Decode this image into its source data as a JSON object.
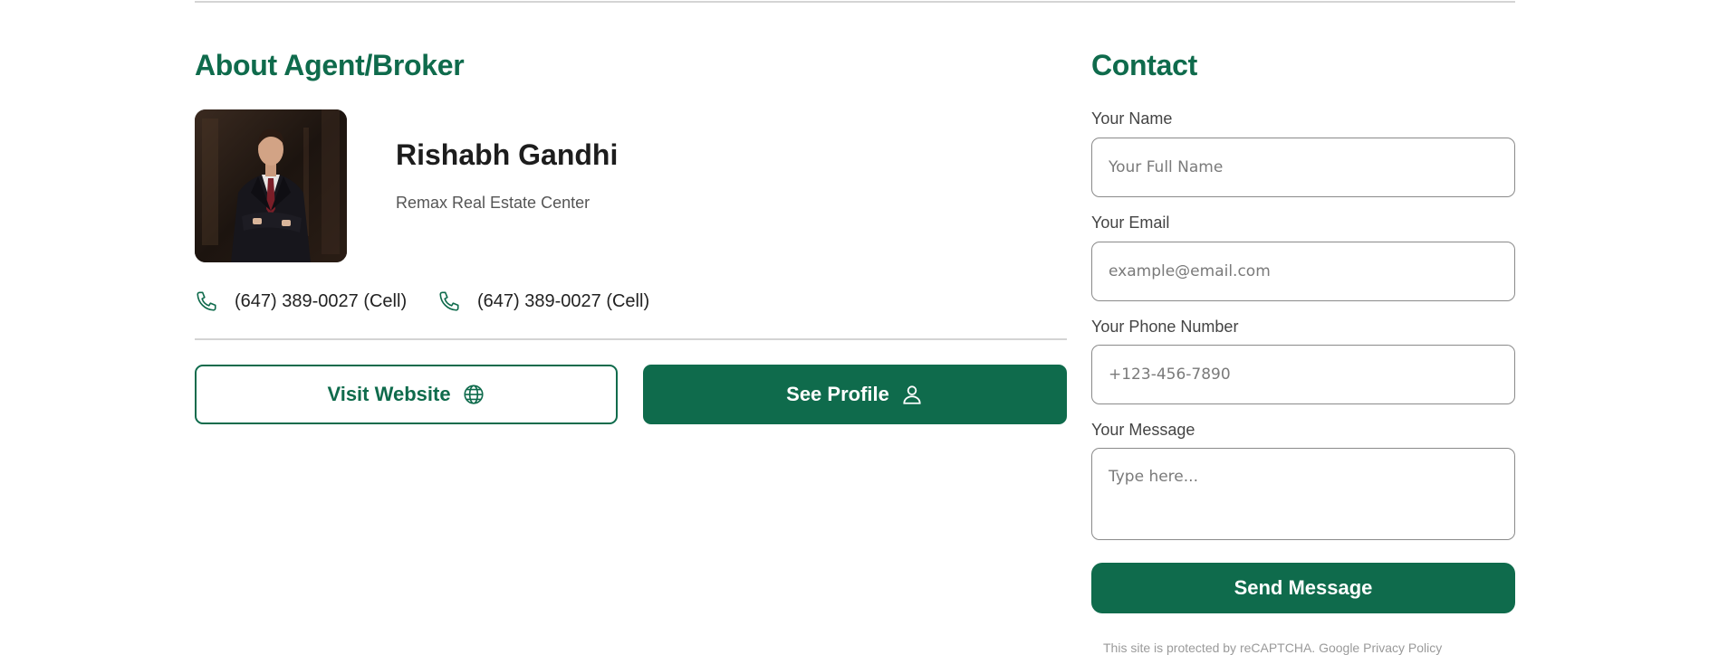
{
  "about": {
    "title": "About Agent/Broker",
    "agent": {
      "name": "Rishabh Gandhi",
      "agency": "Remax Real Estate Center"
    },
    "phones": [
      {
        "number": "(647) 389-0027 (Cell)",
        "icon": "phone-icon"
      },
      {
        "number": "(647) 389-0027 (Cell)",
        "icon": "phone-icon"
      }
    ],
    "buttons": {
      "visit_website": {
        "label": "Visit Website",
        "icon": "globe-icon"
      },
      "see_profile": {
        "label": "See Profile",
        "icon": "user-icon"
      }
    }
  },
  "contact": {
    "title": "Contact",
    "fields": {
      "name": {
        "label": "Your Name",
        "placeholder": "Your Full Name"
      },
      "email": {
        "label": "Your Email",
        "placeholder": "example@email.com"
      },
      "phone": {
        "label": "Your Phone Number",
        "placeholder": "+123-456-7890"
      },
      "message": {
        "label": "Your Message",
        "placeholder": "Type here..."
      }
    },
    "send_label": "Send Message",
    "recaptcha_note": "This site is protected by reCAPTCHA. Google Privacy Policy"
  },
  "colors": {
    "brand_green": "#0f6b4c",
    "divider": "#d4d4d4",
    "field_border": "#8a8a8a"
  }
}
